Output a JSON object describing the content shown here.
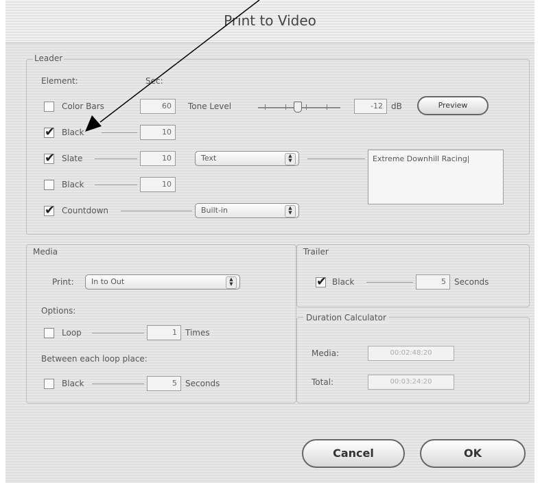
{
  "window": {
    "title": "Print to Video"
  },
  "leader": {
    "group_label": "Leader",
    "element_header": "Element:",
    "sec_header": "Sec:",
    "color_bars": {
      "label": "Color Bars",
      "checked": false,
      "seconds": "60"
    },
    "tone_level": {
      "label": "Tone Level",
      "value": "-12",
      "unit": "dB"
    },
    "preview_label": "Preview",
    "black1": {
      "label": "Black",
      "checked": true,
      "seconds": "10"
    },
    "slate": {
      "label": "Slate",
      "checked": true,
      "seconds": "10",
      "source": "Text",
      "text": "Extreme Downhill Racing|"
    },
    "black2": {
      "label": "Black",
      "checked": false,
      "seconds": "10"
    },
    "countdown": {
      "label": "Countdown",
      "checked": true,
      "type": "Built-in"
    }
  },
  "media": {
    "group_label": "Media",
    "print_label": "Print:",
    "print_value": "In to Out",
    "options_label": "Options:",
    "loop": {
      "label": "Loop",
      "checked": false,
      "times": "1",
      "times_label": "Times"
    },
    "between_label": "Between each loop place:",
    "between_black": {
      "label": "Black",
      "checked": false,
      "seconds": "5",
      "unit": "Seconds"
    }
  },
  "trailer": {
    "group_label": "Trailer",
    "black": {
      "label": "Black",
      "checked": true,
      "seconds": "5",
      "unit": "Seconds"
    }
  },
  "duration": {
    "group_label": "Duration Calculator",
    "media_label": "Media:",
    "media_value": "00:02:48:20",
    "total_label": "Total:",
    "total_value": "00:03:24:20"
  },
  "buttons": {
    "cancel": "Cancel",
    "ok": "OK"
  }
}
